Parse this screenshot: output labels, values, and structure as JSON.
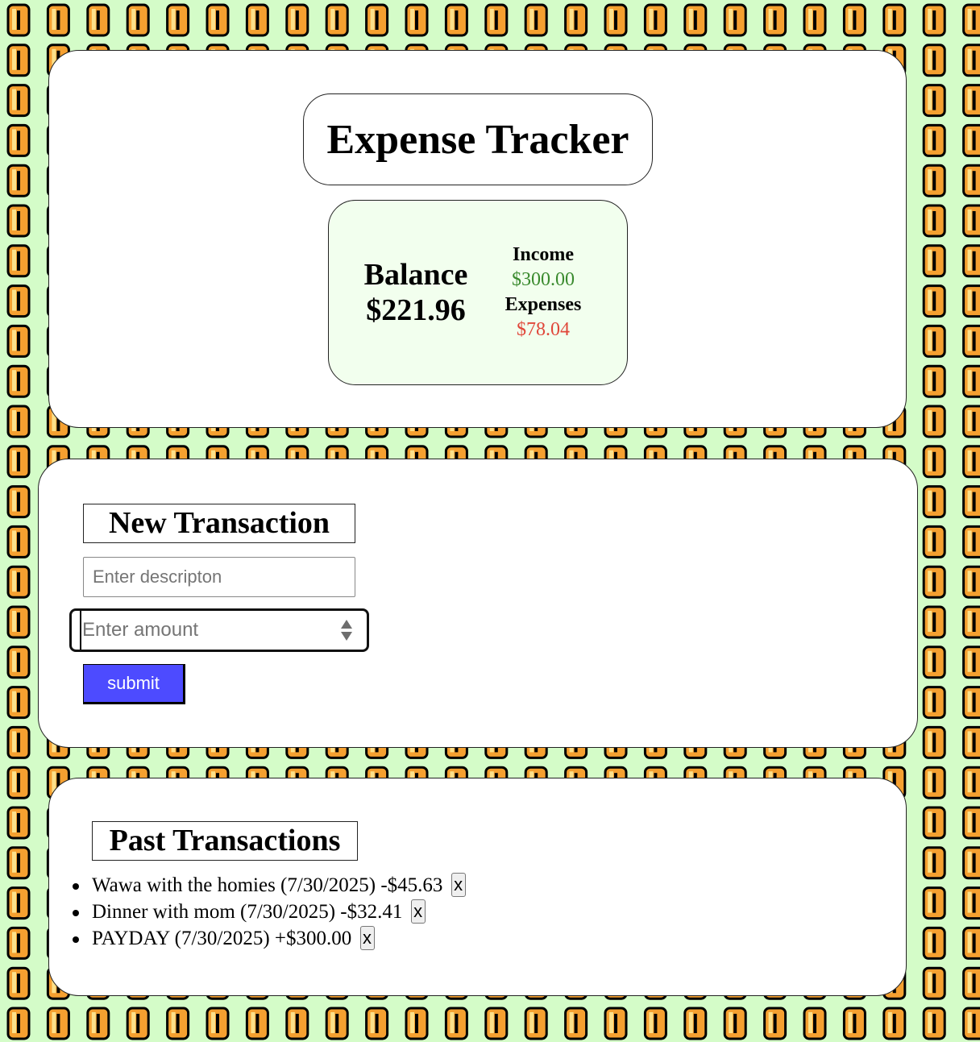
{
  "colors": {
    "page_background": "#d4fcc8",
    "coin_outline": "#000000",
    "coin_fill": "#f5a030",
    "coin_highlight": "#fce08a",
    "income": "#3a8a2e",
    "expense": "#e0473a",
    "submit_button": "#4d4bff",
    "summary_background": "#f2ffee"
  },
  "background": {
    "pattern": "coin-icon"
  },
  "header": {
    "title": "Expense Tracker"
  },
  "summary": {
    "balance_label": "Balance",
    "balance_value": "$221.96",
    "income_label": "Income",
    "income_value": "$300.00",
    "expenses_label": "Expenses",
    "expenses_value": "$78.04"
  },
  "new_transaction": {
    "heading": "New Transaction",
    "description_placeholder": "Enter descripton",
    "description_value": "",
    "amount_placeholder": "Enter amount",
    "amount_value": "",
    "spinner_icon": "spinner-arrows-icon",
    "submit_label": "submit"
  },
  "past_transactions": {
    "heading": "Past Transactions",
    "items": [
      {
        "text": "Wawa with the homies (7/30/2025) -$45.63",
        "delete_label": "x"
      },
      {
        "text": "Dinner with mom (7/30/2025) -$32.41",
        "delete_label": "x"
      },
      {
        "text": "PAYDAY (7/30/2025) +$300.00",
        "delete_label": "x"
      }
    ]
  }
}
